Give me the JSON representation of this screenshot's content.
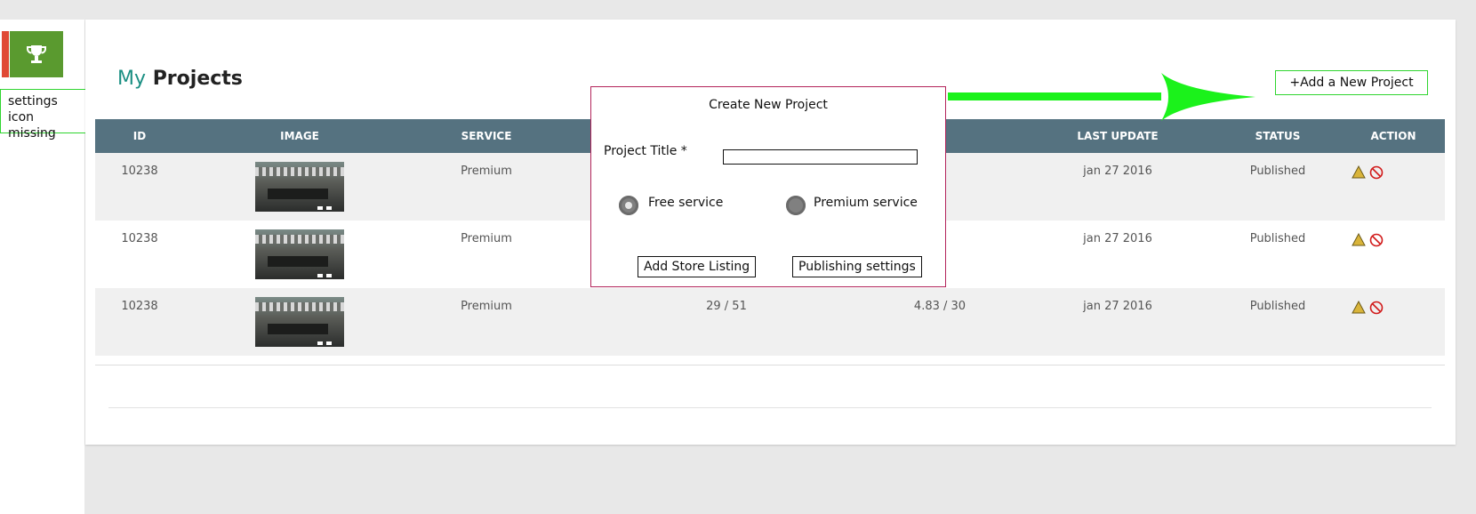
{
  "note": {
    "text_line1": "settings icon",
    "text_line2": "missing"
  },
  "page_title": {
    "accent": "My",
    "rest": "Projects"
  },
  "add_button": "+Add a New Project",
  "table": {
    "headers": [
      "ID",
      "IMAGE",
      "SERVICE",
      "LAST UPDATE",
      "STATUS",
      "ACTION"
    ],
    "rows": [
      {
        "id": "10238",
        "service": "Premium",
        "col4": "",
        "col5": "",
        "last_update": "jan 27 2016",
        "status": "Published"
      },
      {
        "id": "10238",
        "service": "Premium",
        "col4": "",
        "col5": "",
        "last_update": "jan 27 2016",
        "status": "Published"
      },
      {
        "id": "10238",
        "service": "Premium",
        "col4": "29 / 51",
        "col5": "4.83 / 30",
        "last_update": "jan 27 2016",
        "status": "Published"
      }
    ]
  },
  "modal": {
    "title": "Create New Project",
    "field_label": "Project Title *",
    "field_value": "",
    "radio1": "Free service",
    "radio2": "Premium service",
    "btn1": "Add Store Listing",
    "btn2": "Publishing settings"
  },
  "colors": {
    "header_bg": "#557280",
    "accent_green": "#5a9a2f",
    "accent_red": "#e04a35",
    "annotation_green": "#2fd52f",
    "modal_border": "#b3245b",
    "title_accent": "#1b8f83"
  },
  "icons": {
    "trophy": "trophy-icon",
    "warning": "warning-icon",
    "block": "block-icon",
    "arrow": "arrow-annotation"
  }
}
